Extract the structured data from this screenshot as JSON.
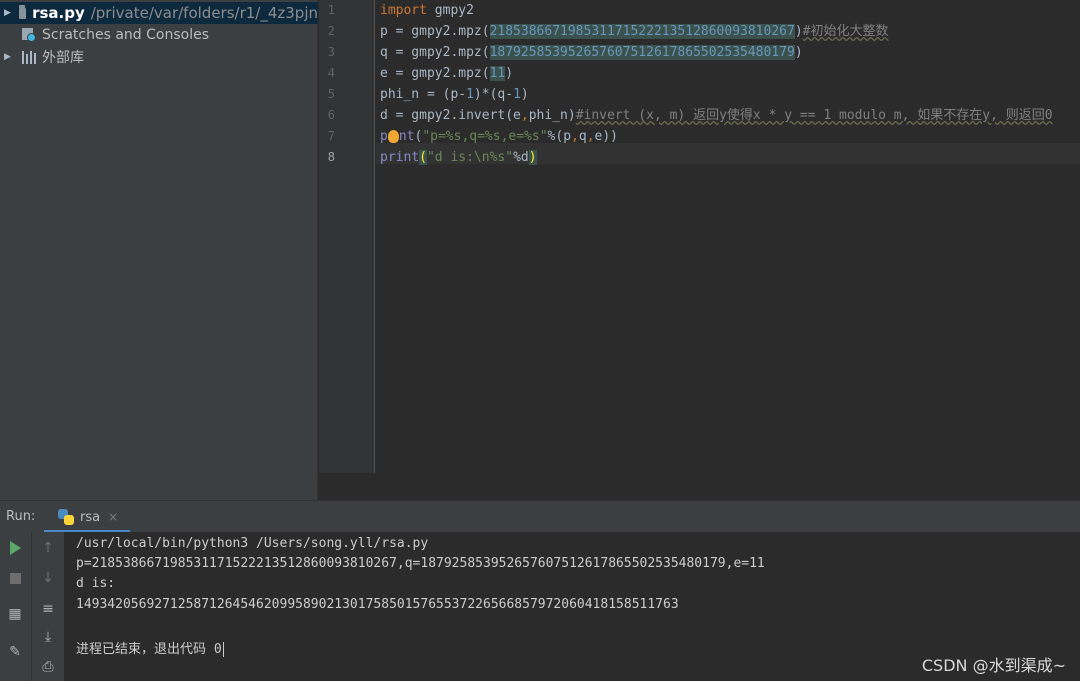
{
  "project": {
    "file_name": "rsa.py",
    "file_path": "/private/var/folders/r1/_4z3pjn",
    "scratches": "Scratches and Consoles",
    "external_libs": "外部库"
  },
  "editor": {
    "line_numbers": [
      "1",
      "2",
      "3",
      "4",
      "5",
      "6",
      "7",
      "8"
    ],
    "lines": [
      {
        "kw": "import",
        "rest": " gmpy2"
      },
      {
        "pre": "p = gmpy2.mpz(",
        "num": "218538667198531171522213512860093810267",
        "post": ")",
        "cmt": "#初始化大整数"
      },
      {
        "pre": "q = gmpy2.mpz(",
        "num": "187925853952657607512617865502535480179",
        "post": ")"
      },
      {
        "pre": "e = gmpy2.mpz(",
        "num": "11",
        "post": ")"
      },
      {
        "a": "phi_n = (p-",
        "n1": "1",
        "b": ")*(q-",
        "n2": "1",
        "c": ")"
      },
      {
        "pre": "d = gmpy2.invert(e",
        "mid": "phi_n)",
        "cmt": "#invert (x, m) 返回y使得x * y == 1 modulo m, 如果不存在y, 则返回0"
      },
      {
        "p1": "p",
        "p2": "nt",
        "s1": "(",
        "str": "\"p=%s,q=%s,e=%s\"",
        "rest": "%(p",
        "rest2": "q",
        "rest3": "e))"
      },
      {
        "fn": "print",
        "br": "(",
        "str": "\"d is:\\n%s\"",
        "rest": "%d",
        "br2": ")"
      }
    ]
  },
  "run": {
    "label": "Run:",
    "tab": "rsa",
    "close": "×",
    "console": [
      "/usr/local/bin/python3 /Users/song.yll/rsa.py",
      "p=218538667198531171522213512860093810267,q=187925853952657607512617865502535480179,e=11",
      "d is:",
      "14934205692712587126454620995890213017585015765537226566857972060418158511763",
      "",
      "进程已结束，退出代码 0"
    ]
  },
  "watermark": "CSDN @水到渠成~",
  "icons": {
    "folder": "folder-icon",
    "scratch": "scratches-icon",
    "libs": "library-icon",
    "python": "python-file-icon",
    "run": "run-play-icon",
    "stop": "stop-icon",
    "up": "arrow-up-icon",
    "down": "arrow-down-icon",
    "wrap": "soft-wrap-icon",
    "scroll": "scroll-to-end-icon",
    "print": "print-icon",
    "layout": "layout-icon",
    "pin": "pin-icon",
    "bulb": "intention-bulb-icon"
  },
  "colors": {
    "keyword": "#cc7832",
    "number": "#6897bb",
    "string": "#6a8759",
    "comment": "#808080",
    "run_green": "#59a869"
  }
}
